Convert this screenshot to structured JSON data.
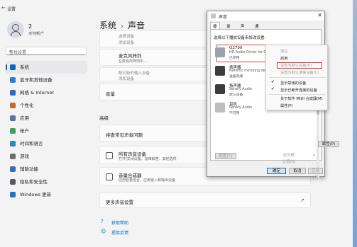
{
  "window": {
    "title": "设置",
    "back_icon": "←"
  },
  "user": {
    "name": "2",
    "role": "本地帐户"
  },
  "search": {
    "placeholder": "查找设置"
  },
  "nav": [
    {
      "label": "系统",
      "color": "#0a67c0",
      "active": true
    },
    {
      "label": "蓝牙和其他设备",
      "color": "#2c7fd8"
    },
    {
      "label": "网络 & Internet",
      "color": "#2d6dbf"
    },
    {
      "label": "个性化",
      "color": "#c86a2f"
    },
    {
      "label": "应用",
      "color": "#5b6fa8"
    },
    {
      "label": "帐户",
      "color": "#3d9e5f"
    },
    {
      "label": "时间和语言",
      "color": "#2d89c2"
    },
    {
      "label": "游戏",
      "color": "#6d6d6d"
    },
    {
      "label": "辅助功能",
      "color": "#3a6bb8"
    },
    {
      "label": "隐私和安全性",
      "color": "#555a66"
    },
    {
      "label": "Windows 更新",
      "color": "#1f73c9"
    }
  ],
  "breadcrumb": {
    "parent": "系统",
    "sep": "›",
    "current": "声音"
  },
  "main": {
    "faded1": "选择设备",
    "faded2": "添加设备",
    "mic_title": "麦克风阵列",
    "mic_sub": "在麦克风阵列中...",
    "faded3": "配对新的输入设备",
    "faded4": "添加设备",
    "volume_label": "音量",
    "advanced_label": "高级",
    "troubleshoot": "排查常见声音问题",
    "troubleshoot_chev": "›",
    "all_devices_title": "所有声音设备",
    "all_devices_sub": "打开/关闭设备，疑难解答，其他选项",
    "all_devices_chev": "›",
    "mixer_title": "音量合成器",
    "mixer_sub": "应用音量混合，应用输入和输出设备",
    "mixer_chev": "›",
    "more_settings": "更多声音设置",
    "more_settings_icon": "↗",
    "help": "获取帮助",
    "feedback": "提供反馈"
  },
  "dialog": {
    "title": "声音",
    "close": "✕",
    "tabs": [
      "播放",
      "录制",
      "声音",
      "通信"
    ],
    "instruction": "选择以下播放设备来修改设置:",
    "devices": [
      {
        "name": "Q2790",
        "sub1": "HD Audio Driver for Dis...",
        "sub2": "已停用"
      },
      {
        "name": "扬声器",
        "sub1": "Nahimic mirroring devi...",
        "sub2": "准备就绪"
      },
      {
        "name": "扬声器",
        "sub1": "Senary Audio",
        "sub2": "默认设备"
      },
      {
        "name": "耳机",
        "sub1": "Senary Audio",
        "sub2": "不可用"
      }
    ],
    "btn_config": "配置(C)",
    "btn_default": "设为默认值(S)",
    "btn_default_arrow": "▾",
    "btn_props": "属性(P)",
    "btn_ok": "确定",
    "btn_cancel": "取消",
    "btn_apply": "应用(A)"
  },
  "context_menu": {
    "items": [
      {
        "label": "测试",
        "disabled": true
      },
      {
        "label": "启用",
        "disabled": false
      },
      {
        "label": "设置为默认设备(D)",
        "disabled": true
      },
      {
        "label": "设置为默认通信设备(C)",
        "disabled": true
      },
      {
        "label": "显示禁用的设备",
        "checked": true
      },
      {
        "label": "显示已断开连接的设备",
        "checked": true
      },
      {
        "label": "关于软件 MIDI 合成器(M)"
      },
      {
        "label": "属性(P)"
      }
    ],
    "check_glyph": "✔"
  }
}
